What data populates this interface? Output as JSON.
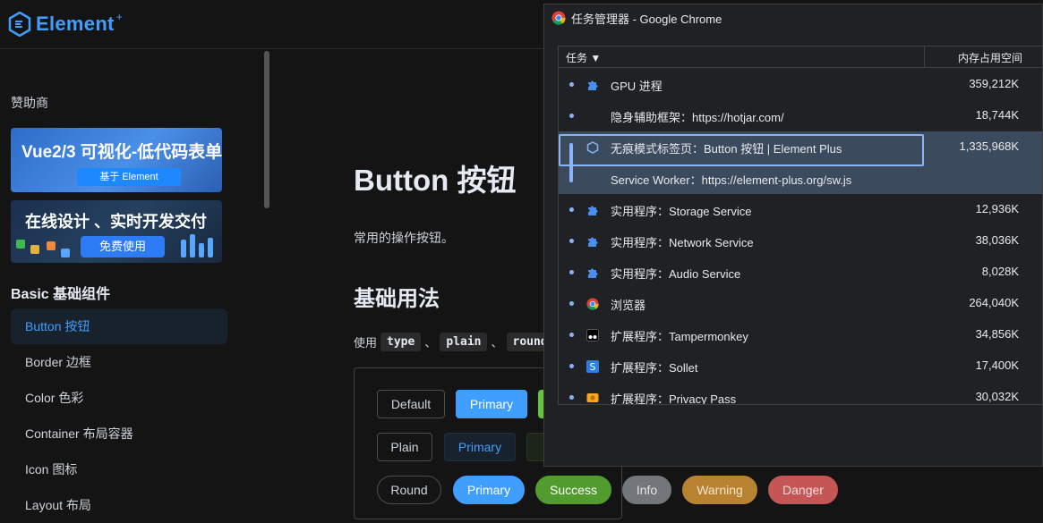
{
  "logo": {
    "text": "Element",
    "plus": "+"
  },
  "sidebar": {
    "sponsor_label": "赞助商",
    "banner1": {
      "title": "Vue2/3 可视化-低代码表单",
      "button": "基于 Element"
    },
    "banner2": {
      "title": "在线设计 、实时开发交付",
      "button": "免费使用"
    },
    "section_title": "Basic 基础组件",
    "items": [
      {
        "label": "Button 按钮",
        "active": true
      },
      {
        "label": "Border 边框",
        "active": false
      },
      {
        "label": "Color 色彩",
        "active": false
      },
      {
        "label": "Container 布局容器",
        "active": false
      },
      {
        "label": "Icon 图标",
        "active": false
      },
      {
        "label": "Layout 布局",
        "active": false
      }
    ]
  },
  "main": {
    "title": "Button 按钮",
    "description": "常用的操作按钮。",
    "heading": "基础用法",
    "usage_prefix": "使用",
    "usage_codes": [
      "type",
      "plain",
      "round"
    ],
    "usage_sep": "、",
    "buttons_row1": [
      "Default",
      "Primary"
    ],
    "buttons_row2": [
      "Plain",
      "Primary"
    ],
    "buttons_row3": [
      "Round",
      "Primary",
      "Success",
      "Info",
      "Warning",
      "Danger"
    ]
  },
  "task_manager": {
    "window_title": "任务管理器 - Google Chrome",
    "col_task": "任务 ▼",
    "col_memory": "内存占用空间",
    "rows": [
      {
        "icon": "puzzle-icon",
        "name": "GPU 进程",
        "memory": "359,212K"
      },
      {
        "icon": "none",
        "name": "隐身辅助框架：https://hotjar.com/",
        "memory": "18,744K"
      },
      {
        "icon": "element-icon",
        "name": "无痕模式标签页：Button 按钮 | Element Plus",
        "memory": "1,335,968K"
      },
      {
        "icon": "none",
        "name": "Service Worker：https://element-plus.org/sw.js",
        "memory": ""
      },
      {
        "icon": "puzzle-icon",
        "name": "实用程序：Storage Service",
        "memory": "12,936K"
      },
      {
        "icon": "puzzle-icon",
        "name": "实用程序：Network Service",
        "memory": "38,036K"
      },
      {
        "icon": "puzzle-icon",
        "name": "实用程序：Audio Service",
        "memory": "8,028K"
      },
      {
        "icon": "chrome-icon",
        "name": "浏览器",
        "memory": "264,040K"
      },
      {
        "icon": "tampermonkey-icon",
        "name": "扩展程序：Tampermonkey",
        "memory": "34,856K"
      },
      {
        "icon": "sollet-icon",
        "name": "扩展程序：Sollet",
        "memory": "17,400K"
      },
      {
        "icon": "privacy-pass-icon",
        "name": "扩展程序：Privacy Pass",
        "memory": "30,032K"
      }
    ]
  },
  "colors": {
    "accent": "#409eff",
    "success": "#67c23a",
    "selection": "#8ab4f8"
  }
}
